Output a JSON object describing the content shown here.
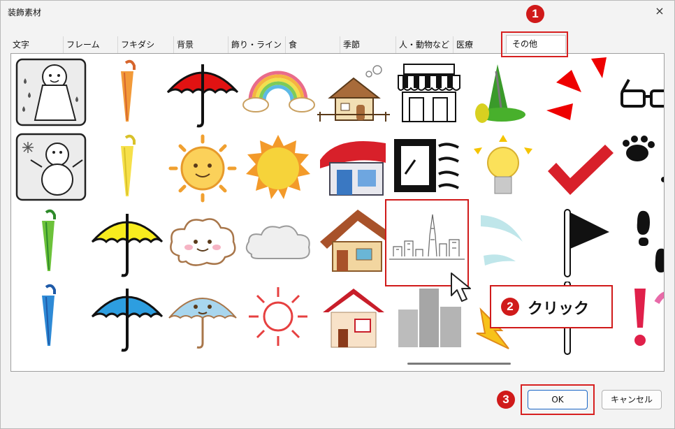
{
  "dialog": {
    "title": "装飾素材",
    "close_symbol": "×"
  },
  "tabs": [
    "文字",
    "フレーム",
    "フキダシ",
    "背景",
    "飾り・ライン",
    "食",
    "季節",
    "人・動物など",
    "医療",
    "その他"
  ],
  "active_tab": "その他",
  "thumbnails": [
    {
      "name": "teru-teru-bozu-rain-thumbnail"
    },
    {
      "name": "orange-umbrella-closed-thumbnail"
    },
    {
      "name": "red-umbrella-thumbnail"
    },
    {
      "name": "rainbow-thumbnail"
    },
    {
      "name": "house-with-chimney-thumbnail"
    },
    {
      "name": "shop-thumbnail"
    },
    {
      "name": "tower-park-thumbnail"
    },
    {
      "name": "red-emphasis-lines-thumbnail"
    },
    {
      "name": "glasses-thumbnail"
    },
    {
      "name": "snowman-thumbnail"
    },
    {
      "name": "yellow-umbrella-closed-thumbnail"
    },
    {
      "name": "sun-face-thumbnail"
    },
    {
      "name": "sun-thumbnail"
    },
    {
      "name": "red-roof-shop-thumbnail"
    },
    {
      "name": "window-wind-thumbnail"
    },
    {
      "name": "light-bulb-thumbnail"
    },
    {
      "name": "red-check-mark-thumbnail"
    },
    {
      "name": "paw-prints-thumbnail"
    },
    {
      "name": "green-umbrella-closed-thumbnail"
    },
    {
      "name": "yellow-umbrella-thumbnail"
    },
    {
      "name": "cloud-face-thumbnail"
    },
    {
      "name": "gray-cloud-thumbnail"
    },
    {
      "name": "brown-roof-house-thumbnail"
    },
    {
      "name": "city-skyline-thumbnail"
    },
    {
      "name": "wind-swoosh-thumbnail"
    },
    {
      "name": "black-flag-thumbnail"
    },
    {
      "name": "footprints-thumbnail"
    },
    {
      "name": "blue-umbrella-closed-thumbnail"
    },
    {
      "name": "blue-umbrella-thumbnail"
    },
    {
      "name": "umbrella-face-thumbnail"
    },
    {
      "name": "sun-lines-thumbnail"
    },
    {
      "name": "red-roof-house-thumbnail"
    },
    {
      "name": "gray-buildings-thumbnail"
    },
    {
      "name": "lightning-thumbnail"
    },
    {
      "name": "pole-thumbnail"
    },
    {
      "name": "exclamation-thumbnail"
    }
  ],
  "selected_item": "city-skyline-thumbnail",
  "annotations": {
    "step1": "1",
    "step2": "2",
    "step2_label": "クリック",
    "step3": "3"
  },
  "buttons": {
    "ok": "OK",
    "cancel": "キャンセル"
  },
  "colors": {
    "accent": "#d01a1a",
    "ok_border": "#1a66c6"
  }
}
